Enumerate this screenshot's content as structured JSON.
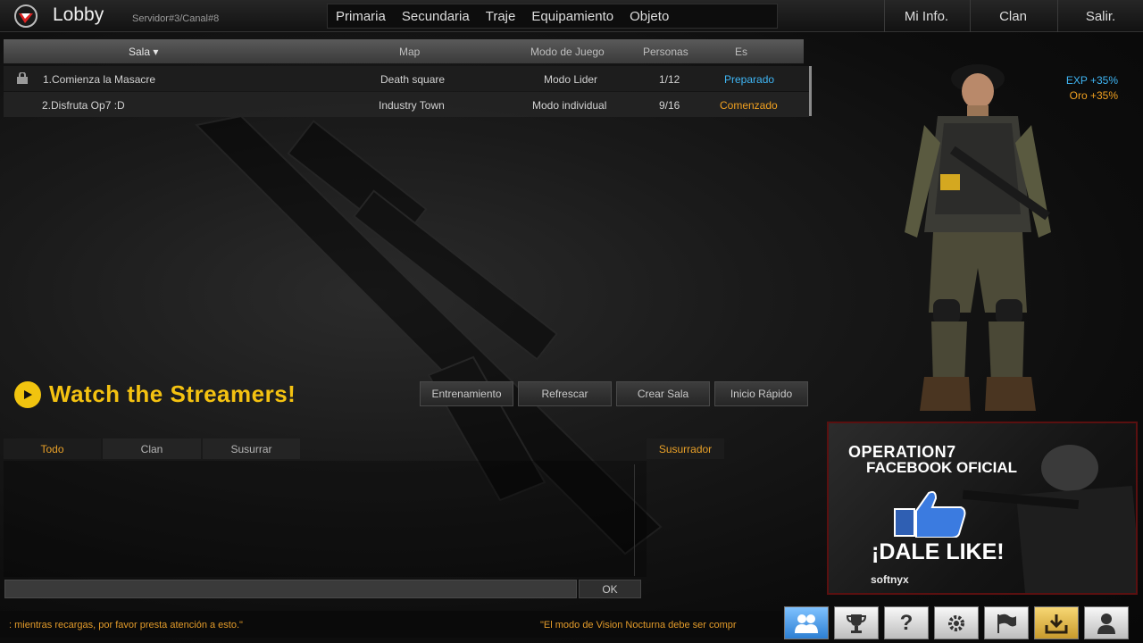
{
  "header": {
    "title": "Lobby",
    "server": "Servidor#3/Canal#8",
    "menu": [
      "Primaria",
      "Secundaria",
      "Traje",
      "Equipamiento",
      "Objeto"
    ],
    "right_menu": [
      "Mi Info.",
      "Clan",
      "Salir."
    ]
  },
  "room_table": {
    "columns": [
      "Sala ▾",
      "Map",
      "Modo de Juego",
      "Personas",
      "Es"
    ],
    "rows": [
      {
        "name": "1.Comienza la Masacre",
        "map": "Death square",
        "mode": "Modo Lider",
        "people": "1/12",
        "status": "Preparado",
        "status_color": "#3fb6f5",
        "locked": true
      },
      {
        "name": "2.Disfruta Op7 :D",
        "map": "Industry Town",
        "mode": "Modo individual",
        "people": "9/16",
        "status": "Comenzado",
        "status_color": "#f0a020",
        "locked": false
      }
    ]
  },
  "banner": {
    "text": "Watch the Streamers!"
  },
  "actions": [
    "Entrenamiento",
    "Refrescar",
    "Crear Sala",
    "Inicio Rápido"
  ],
  "chat": {
    "tabs": [
      "Todo",
      "Clan",
      "Susurrar"
    ],
    "whisper_tab": "Susurrador",
    "input_value": "",
    "ok_label": "OK"
  },
  "ticker": {
    "left": ": mientras recargas, por favor presta atención a esto.\"",
    "right": "\"El modo de Vision Nocturna debe ser compr"
  },
  "bonuses": {
    "exp": "EXP +35%",
    "gold": "Oro +35%"
  },
  "ad": {
    "title": "OPERATION7",
    "subtitle": "FACEBOOK OFICIAL",
    "cta": "¡DALE LIKE!",
    "brand": "softnyx"
  },
  "icon_bar": [
    "friends-icon",
    "trophy-icon",
    "help-icon",
    "gear-icon",
    "flag-icon",
    "download-icon",
    "profile-icon"
  ],
  "colors": {
    "accent_gold": "#f4c211",
    "ready": "#3fb6f5",
    "started": "#f0a020"
  }
}
